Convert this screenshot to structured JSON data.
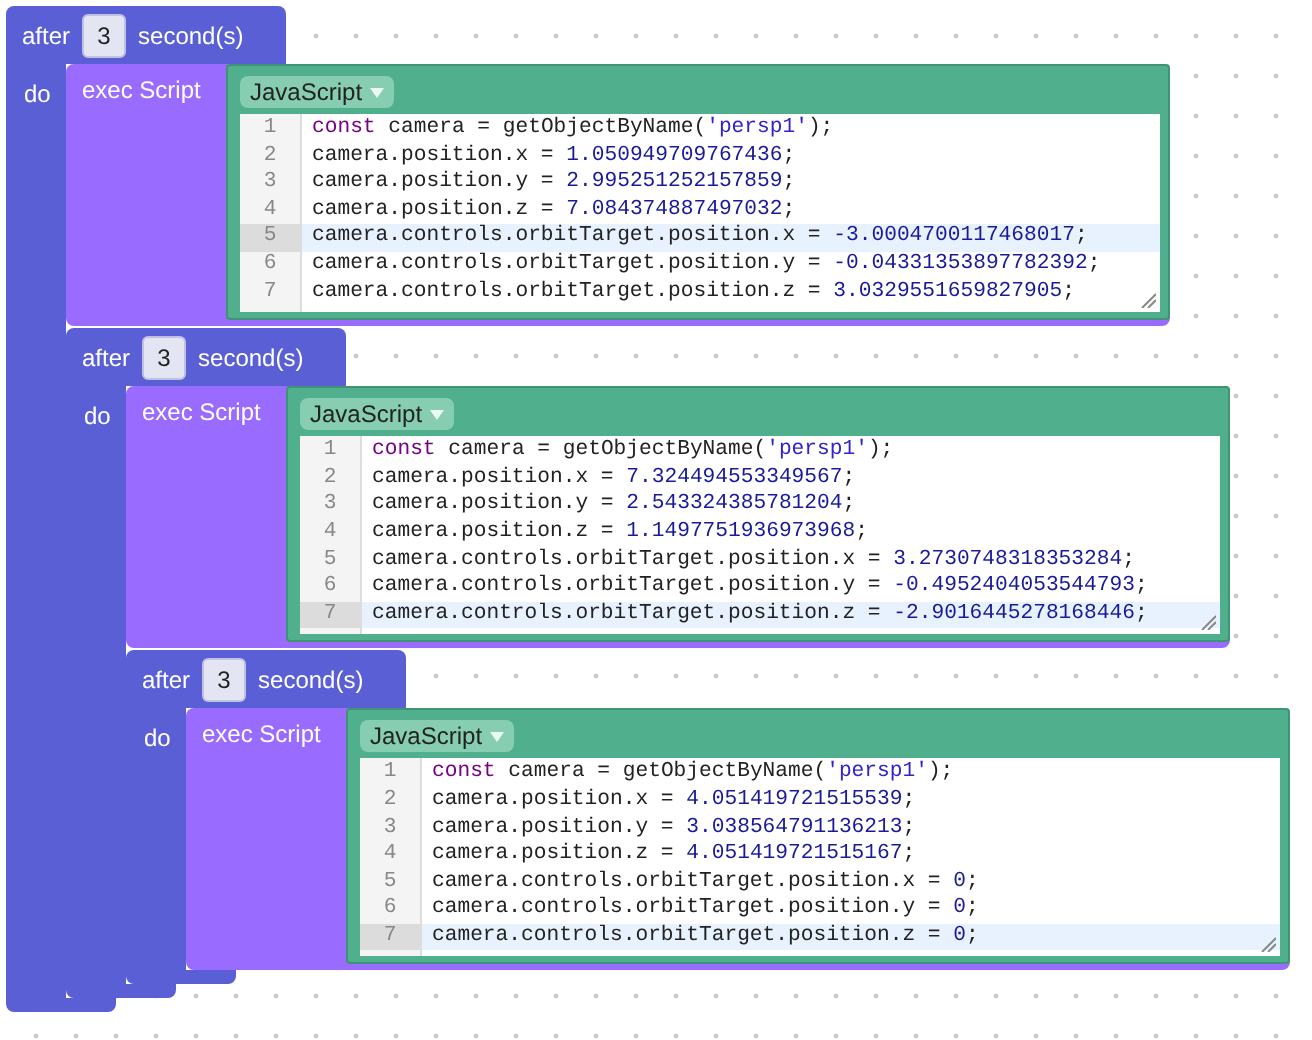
{
  "timer": {
    "label": "after",
    "seconds": "3",
    "unit": "second(s)",
    "do_label": "do",
    "script": {
      "label": "exec Script",
      "language": "JavaScript",
      "lines": [
        {
          "number": "1",
          "active": false,
          "tokens": [
            {
              "kind": "keyword",
              "text": "const"
            },
            {
              "kind": "plain",
              "text": " camera = getObjectByName("
            },
            {
              "kind": "string",
              "text": "'persp1'"
            },
            {
              "kind": "plain",
              "text": ");"
            }
          ]
        },
        {
          "number": "2",
          "active": false,
          "tokens": [
            {
              "kind": "plain",
              "text": "camera.position.x = "
            },
            {
              "kind": "number",
              "text": "1.050949709767436"
            },
            {
              "kind": "plain",
              "text": ";"
            }
          ]
        },
        {
          "number": "3",
          "active": false,
          "tokens": [
            {
              "kind": "plain",
              "text": "camera.position.y = "
            },
            {
              "kind": "number",
              "text": "2.995251252157859"
            },
            {
              "kind": "plain",
              "text": ";"
            }
          ]
        },
        {
          "number": "4",
          "active": false,
          "tokens": [
            {
              "kind": "plain",
              "text": "camera.position.z = "
            },
            {
              "kind": "number",
              "text": "7.084374887497032"
            },
            {
              "kind": "plain",
              "text": ";"
            }
          ]
        },
        {
          "number": "5",
          "active": true,
          "tokens": [
            {
              "kind": "plain",
              "text": "camera.controls.orbitTarget.position.x = "
            },
            {
              "kind": "number",
              "text": "-3.0004700117468017"
            },
            {
              "kind": "plain",
              "text": ";"
            }
          ]
        },
        {
          "number": "6",
          "active": false,
          "tokens": [
            {
              "kind": "plain",
              "text": "camera.controls.orbitTarget.position.y = "
            },
            {
              "kind": "number",
              "text": "-0.04331353897782392"
            },
            {
              "kind": "plain",
              "text": ";"
            }
          ]
        },
        {
          "number": "7",
          "active": false,
          "tokens": [
            {
              "kind": "plain",
              "text": "camera.controls.orbitTarget.position.z = "
            },
            {
              "kind": "number",
              "text": "3.0329551659827905"
            },
            {
              "kind": "plain",
              "text": ";"
            }
          ]
        }
      ]
    },
    "next": {
      "label": "after",
      "seconds": "3",
      "unit": "second(s)",
      "do_label": "do",
      "script": {
        "label": "exec Script",
        "language": "JavaScript",
        "lines": [
          {
            "number": "1",
            "active": false,
            "tokens": [
              {
                "kind": "keyword",
                "text": "const"
              },
              {
                "kind": "plain",
                "text": " camera = getObjectByName("
              },
              {
                "kind": "string",
                "text": "'persp1'"
              },
              {
                "kind": "plain",
                "text": ");"
              }
            ]
          },
          {
            "number": "2",
            "active": false,
            "tokens": [
              {
                "kind": "plain",
                "text": "camera.position.x = "
              },
              {
                "kind": "number",
                "text": "7.324494553349567"
              },
              {
                "kind": "plain",
                "text": ";"
              }
            ]
          },
          {
            "number": "3",
            "active": false,
            "tokens": [
              {
                "kind": "plain",
                "text": "camera.position.y = "
              },
              {
                "kind": "number",
                "text": "2.543324385781204"
              },
              {
                "kind": "plain",
                "text": ";"
              }
            ]
          },
          {
            "number": "4",
            "active": false,
            "tokens": [
              {
                "kind": "plain",
                "text": "camera.position.z = "
              },
              {
                "kind": "number",
                "text": "1.1497751936973968"
              },
              {
                "kind": "plain",
                "text": ";"
              }
            ]
          },
          {
            "number": "5",
            "active": false,
            "tokens": [
              {
                "kind": "plain",
                "text": "camera.controls.orbitTarget.position.x = "
              },
              {
                "kind": "number",
                "text": "3.2730748318353284"
              },
              {
                "kind": "plain",
                "text": ";"
              }
            ]
          },
          {
            "number": "6",
            "active": false,
            "tokens": [
              {
                "kind": "plain",
                "text": "camera.controls.orbitTarget.position.y = "
              },
              {
                "kind": "number",
                "text": "-0.4952404053544793"
              },
              {
                "kind": "plain",
                "text": ";"
              }
            ]
          },
          {
            "number": "7",
            "active": true,
            "tokens": [
              {
                "kind": "plain",
                "text": "camera.controls.orbitTarget.position.z = "
              },
              {
                "kind": "number",
                "text": "-2.9016445278168446"
              },
              {
                "kind": "plain",
                "text": ";"
              }
            ]
          }
        ]
      },
      "next": {
        "label": "after",
        "seconds": "3",
        "unit": "second(s)",
        "do_label": "do",
        "script": {
          "label": "exec Script",
          "language": "JavaScript",
          "lines": [
            {
              "number": "1",
              "active": false,
              "tokens": [
                {
                  "kind": "keyword",
                  "text": "const"
                },
                {
                  "kind": "plain",
                  "text": " camera = getObjectByName("
                },
                {
                  "kind": "string",
                  "text": "'persp1'"
                },
                {
                  "kind": "plain",
                  "text": ");"
                }
              ]
            },
            {
              "number": "2",
              "active": false,
              "tokens": [
                {
                  "kind": "plain",
                  "text": "camera.position.x = "
                },
                {
                  "kind": "number",
                  "text": "4.051419721515539"
                },
                {
                  "kind": "plain",
                  "text": ";"
                }
              ]
            },
            {
              "number": "3",
              "active": false,
              "tokens": [
                {
                  "kind": "plain",
                  "text": "camera.position.y = "
                },
                {
                  "kind": "number",
                  "text": "3.038564791136213"
                },
                {
                  "kind": "plain",
                  "text": ";"
                }
              ]
            },
            {
              "number": "4",
              "active": false,
              "tokens": [
                {
                  "kind": "plain",
                  "text": "camera.position.z = "
                },
                {
                  "kind": "number",
                  "text": "4.051419721515167"
                },
                {
                  "kind": "plain",
                  "text": ";"
                }
              ]
            },
            {
              "number": "5",
              "active": false,
              "tokens": [
                {
                  "kind": "plain",
                  "text": "camera.controls.orbitTarget.position.x = "
                },
                {
                  "kind": "number",
                  "text": "0"
                },
                {
                  "kind": "plain",
                  "text": ";"
                }
              ]
            },
            {
              "number": "6",
              "active": false,
              "tokens": [
                {
                  "kind": "plain",
                  "text": "camera.controls.orbitTarget.position.y = "
                },
                {
                  "kind": "number",
                  "text": "0"
                },
                {
                  "kind": "plain",
                  "text": ";"
                }
              ]
            },
            {
              "number": "7",
              "active": true,
              "tokens": [
                {
                  "kind": "plain",
                  "text": "camera.controls.orbitTarget.position.z = "
                },
                {
                  "kind": "number",
                  "text": "0"
                },
                {
                  "kind": "plain",
                  "text": ";"
                }
              ]
            }
          ]
        }
      }
    }
  }
}
